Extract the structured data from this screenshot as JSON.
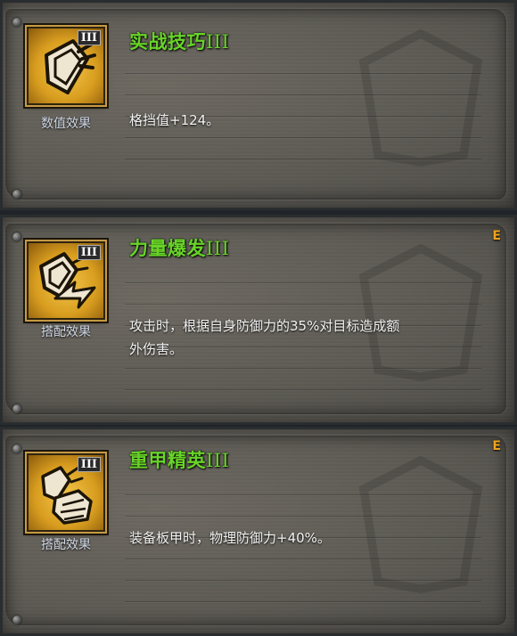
{
  "cards": [
    {
      "title": "实战技巧",
      "tier": "III",
      "category": "数值效果",
      "description": "格挡值+124。",
      "grade": "",
      "icon": "shield-crest-icon"
    },
    {
      "title": "力量爆发",
      "tier": "III",
      "category": "搭配效果",
      "description_line1": "攻击时，根据自身防御力的35%对目标造成额",
      "description_line2": "外伤害。",
      "grade": "E",
      "icon": "shield-strike-icon"
    },
    {
      "title": "重甲精英",
      "tier": "III",
      "category": "搭配效果",
      "description": "装备板甲时，物理防御力+40%。",
      "grade": "E",
      "icon": "armored-gauntlet-icon"
    }
  ],
  "colors": {
    "title_green": "#68d428",
    "grade_orange": "#f0a41a",
    "icon_gold": "#d89d1f",
    "parchment": "#5d5a54"
  }
}
